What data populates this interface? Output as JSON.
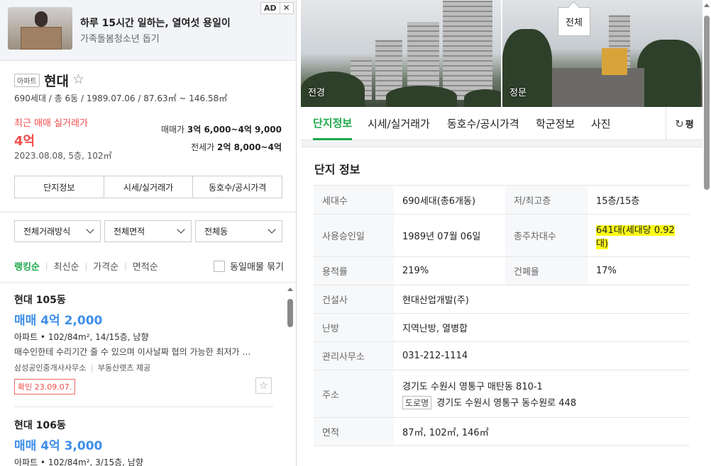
{
  "ad": {
    "badge_ad": "AD",
    "badge_close": "✕",
    "title": "하루 15시간 일하는, 열여섯 용일이",
    "subtitle": "가족돌봄청소년 돕기"
  },
  "complex": {
    "type_tag": "아파트",
    "name": "현대",
    "star": "☆",
    "summary": "690세대 / 총 6동 / 1989.07.06 / 87.63㎡ ~ 146.58㎡",
    "recent_label": "최근 매매 실거래가",
    "recent_price": "4억",
    "recent_date": "2023.08.08, 5층, 102㎡",
    "sale_label": "매매가",
    "sale_value": "3억 6,000~4억 9,000",
    "lease_label": "전세가",
    "lease_value": "2억 8,000~4억"
  },
  "left_tabs": [
    "단지정보",
    "시세/실거래가",
    "동호수/공시가격"
  ],
  "filters": [
    "전체거래방식",
    "전체면적",
    "전체동"
  ],
  "sort": {
    "options": [
      "랭킹순",
      "최신순",
      "가격순",
      "면적순"
    ],
    "group_label": "동일매물 묶기"
  },
  "listings": [
    {
      "name": "현대 105동",
      "price": "매매 4억 2,000",
      "desc": "아파트 • 102/84m², 14/15층, 남향",
      "note": "매수인한테 수리기간 줄 수 있으며 이사날짜 협의 가능한 최저가 …",
      "agency": "삼성공인중개사사무소",
      "provider": "부동산렛츠 제공",
      "confirm": "확인 23.09.07.",
      "star": "☆"
    },
    {
      "name": "현대 106동",
      "price": "매매 4억 3,000",
      "desc": "아파트 • 102/84m², 3/15층, 남향"
    }
  ],
  "photos": {
    "label1": "전경",
    "label2": "정문",
    "all": "전체"
  },
  "right_tabs": [
    "단지정보",
    "시세/실거래가",
    "동호수/공시가격",
    "학군정보",
    "사진"
  ],
  "right_tab_extra": {
    "icon": "↻",
    "label": "평"
  },
  "info": {
    "title": "단지 정보",
    "households_label": "세대수",
    "households_value": "690세대(총6개동)",
    "floors_label": "저/최고층",
    "floors_value": "15층/15층",
    "approval_label": "사용승인일",
    "approval_value": "1989년 07월 06일",
    "parking_label": "총주차대수",
    "parking_value": "641대(세대당 0.92대)",
    "far_label": "용적률",
    "far_value": "219%",
    "bcr_label": "건폐율",
    "bcr_value": "17%",
    "builder_label": "건설사",
    "builder_value": "현대산업개발(주)",
    "heating_label": "난방",
    "heating_value": "지역난방, 열병합",
    "office_label": "관리사무소",
    "office_value": "031-212-1114",
    "address_label": "주소",
    "address_lot": "경기도 수원시 영통구 매탄동 810-1",
    "road_tag": "도로명",
    "address_road": "경기도 수원시 영통구 동수원로 448",
    "area_label": "면적",
    "area_value": "87㎡, 102㎡, 146㎡"
  }
}
